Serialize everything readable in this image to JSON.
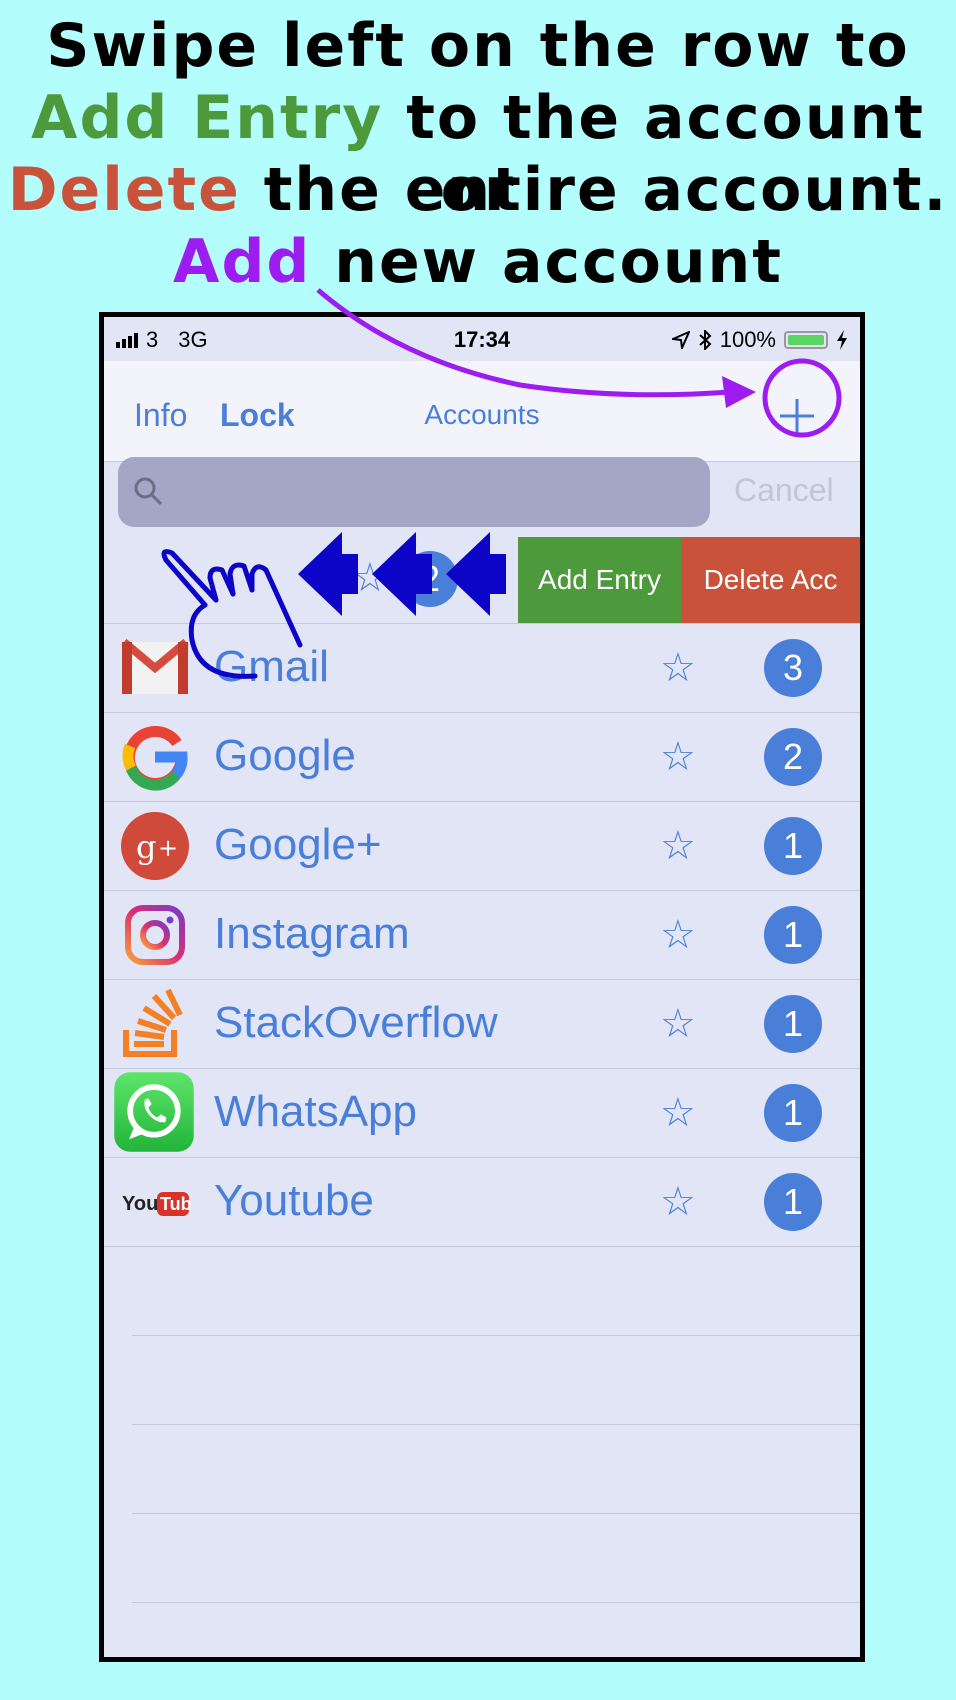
{
  "caption": {
    "line1": "Swipe left on the row to",
    "line2_green": "Add Entry",
    "line2_rest": " to the account or",
    "line3_red": "Delete",
    "line3_rest": " the entire account.",
    "line4_purple": "Add",
    "line4_rest": " new account"
  },
  "colors": {
    "background": "#b3fdfd",
    "accent_blue": "#4a7fd9",
    "add_green": "#4d9a3c",
    "delete_red": "#c9533a",
    "annotation_purple": "#9d1df0",
    "gesture_blue": "#0c05c8"
  },
  "status": {
    "carrier": "3",
    "network": "3G",
    "time": "17:34",
    "battery": "100%",
    "icons": [
      "signal-icon",
      "location-icon",
      "bluetooth-icon",
      "battery-icon",
      "charging-icon"
    ]
  },
  "nav": {
    "info": "Info",
    "lock": "Lock",
    "title": "Accounts",
    "add_icon": "plus-icon"
  },
  "search": {
    "placeholder": "",
    "cancel": "Cancel"
  },
  "swipe": {
    "ghost_badge": "2",
    "add_entry": "Add Entry",
    "delete": "Delete Acc"
  },
  "accounts": [
    {
      "name": "Gmail",
      "count": "3",
      "icon": "gmail-icon"
    },
    {
      "name": "Google",
      "count": "2",
      "icon": "google-icon"
    },
    {
      "name": "Google+",
      "count": "1",
      "icon": "google-plus-icon"
    },
    {
      "name": "Instagram",
      "count": "1",
      "icon": "instagram-icon"
    },
    {
      "name": "StackOverflow",
      "count": "1",
      "icon": "stackoverflow-icon"
    },
    {
      "name": "WhatsApp",
      "count": "1",
      "icon": "whatsapp-icon"
    },
    {
      "name": "Youtube",
      "count": "1",
      "icon": "youtube-icon"
    }
  ]
}
